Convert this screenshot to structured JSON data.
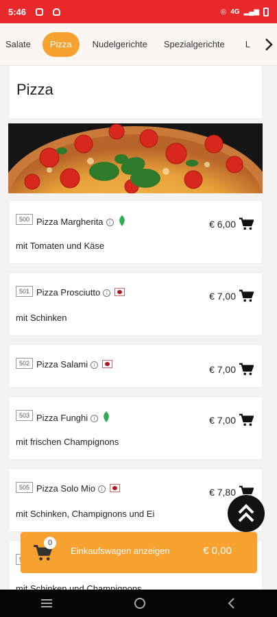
{
  "status": {
    "time": "5:46",
    "network": "4G"
  },
  "categories": {
    "items": [
      "Salate",
      "Pizza",
      "Nudelgerichte",
      "Spezialgerichte",
      "L"
    ],
    "active": "Pizza"
  },
  "section": {
    "title": "Pizza"
  },
  "items": [
    {
      "code": "500",
      "name": "Pizza Margherita",
      "desc": "mit Tomaten und Käse",
      "price": "€ 6,00",
      "badge": "vegetarian-leaf"
    },
    {
      "code": "501",
      "name": "Pizza Prosciutto",
      "desc": "mit Schinken",
      "price": "€ 7,00",
      "badge": "pork-flag"
    },
    {
      "code": "502",
      "name": "Pizza Salami",
      "desc": "",
      "price": "€ 7,00",
      "badge": "pork-flag"
    },
    {
      "code": "503",
      "name": "Pizza Funghi",
      "desc": "mit frischen Champignons",
      "price": "€ 7,00",
      "badge": "vegetarian-leaf"
    },
    {
      "code": "505",
      "name": "Pizza Solo Mio",
      "desc": "mit Schinken, Champignons und Ei",
      "price": "€ 7,80",
      "badge": "pork-flag"
    },
    {
      "code": "5",
      "name": "",
      "desc": "mit Schinken und Champignons",
      "price": "",
      "badge": ""
    }
  ],
  "cart": {
    "count": "0",
    "label": "Einkaufswagen anzeigen",
    "total": "€ 0,00"
  },
  "colors": {
    "status_red": "#e8282b",
    "accent_orange": "#f7a12f",
    "leaf_green": "#2eae4f"
  }
}
